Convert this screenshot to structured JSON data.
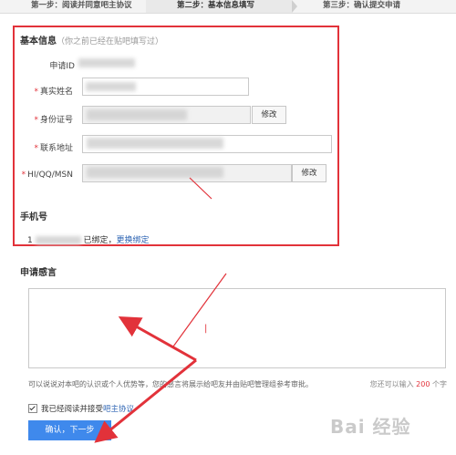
{
  "steps": [
    {
      "label": "第一步：阅读并同意吧主协议"
    },
    {
      "label": "第二步：基本信息填写"
    },
    {
      "label": "第三步：确认提交申请"
    }
  ],
  "basic_info": {
    "title": "基本信息",
    "hint": "（你之前已经在贴吧填写过）",
    "apply_id_label": "申请ID",
    "real_name_label": "真实姓名",
    "id_card_label": "身份证号",
    "id_card_button": "修改",
    "address_label": "联系地址",
    "im_label": "HI/QQ/MSN",
    "im_button": "修改"
  },
  "phone": {
    "title": "手机号",
    "prefix": "1",
    "status": "已绑定，",
    "change_link": "更换绑定"
  },
  "apply_words": {
    "title": "申请感言",
    "cursor_char": "|",
    "footnote": "可以说说对本吧的认识或个人优势等，您的感言将展示给吧友并由贴吧管理组参考审批。",
    "counter_prefix": "您还可以输入",
    "counter_value": "200",
    "counter_suffix": "个字"
  },
  "agreement": {
    "label_prefix": "我已经阅读并接受",
    "label_link": "吧主协议"
  },
  "submit": {
    "label": "确认，下一步"
  },
  "watermark": {
    "text": "Bai 经验"
  },
  "colors": {
    "accent": "#e2323a",
    "primary": "#3f89ec",
    "link": "#2d64b3"
  }
}
